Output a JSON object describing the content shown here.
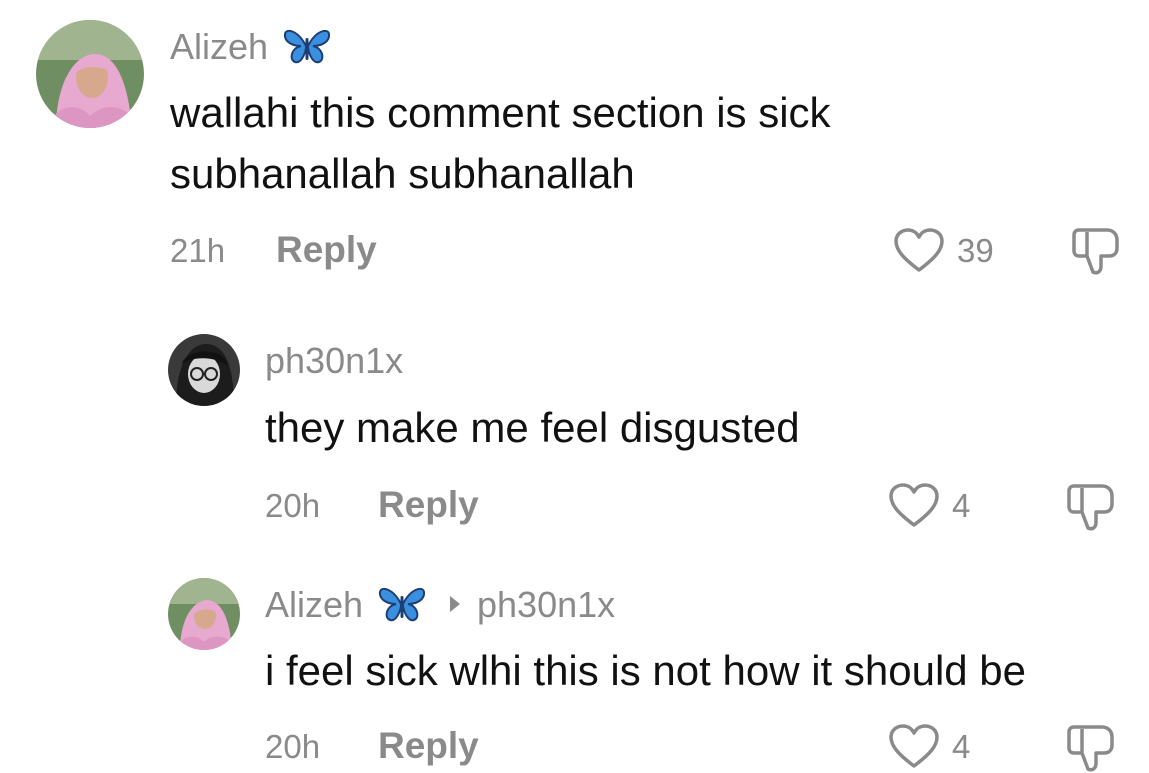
{
  "comments": [
    {
      "username": "Alizeh",
      "text_lines": [
        "wallahi this comment section is sick",
        "subhanallah subhanallah"
      ],
      "time": "21h",
      "reply_label": "Reply",
      "likes": "39"
    },
    {
      "username": "ph30n1x",
      "text": "they make me feel disgusted",
      "time": "20h",
      "reply_label": "Reply",
      "likes": "4"
    },
    {
      "username": "Alizeh",
      "reply_to": "ph30n1x",
      "text": "i feel sick wlhi this is not how it should be",
      "time": "20h",
      "reply_label": "Reply",
      "likes": "4"
    }
  ],
  "icons": {
    "badge": "butterfly-icon",
    "like": "heart-icon",
    "dislike": "thumbs-down-icon",
    "reply_arrow": "triangle-right-icon"
  },
  "colors": {
    "butterfly": "#3b8fe0",
    "secondary_text": "#8a8a8a",
    "primary_text": "#111111"
  }
}
